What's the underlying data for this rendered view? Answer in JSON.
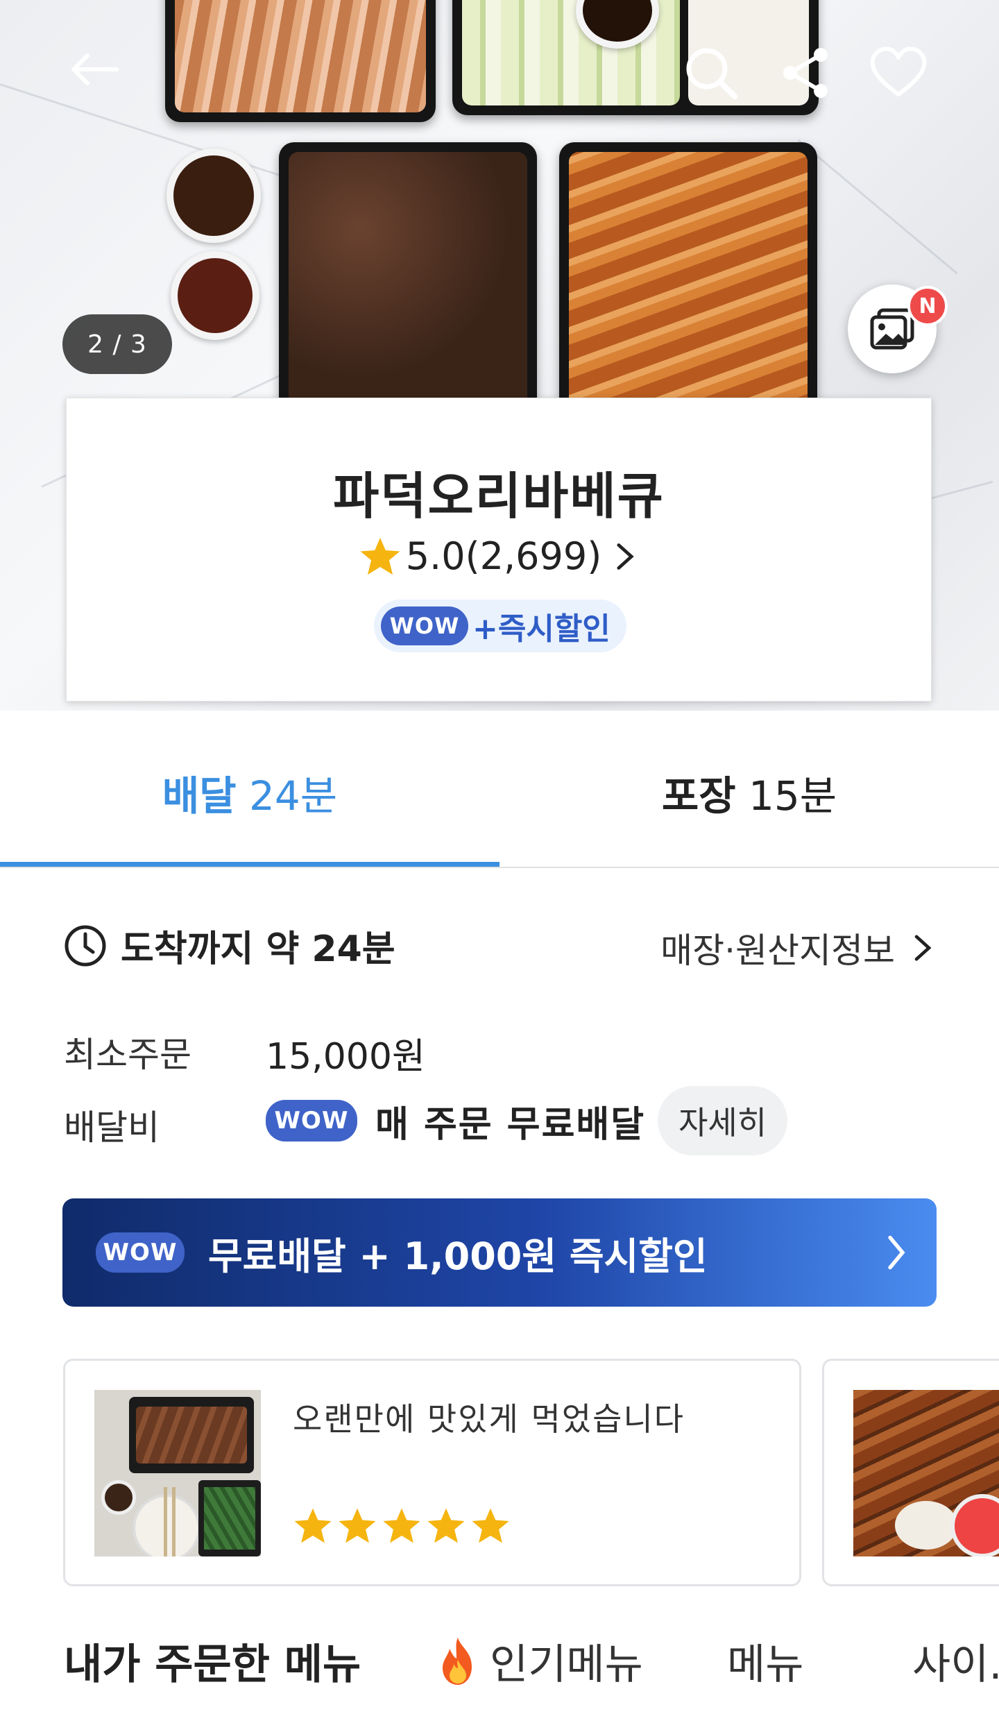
{
  "hero": {
    "image_counter": "2 / 3",
    "gallery_new_badge": "N"
  },
  "store": {
    "name": "파덕오리바베큐",
    "rating": "5.0",
    "review_count": "(2,699)",
    "wow_label": "WOW",
    "instant_discount_label": "+즉시할인"
  },
  "tabs": {
    "delivery": {
      "label": "배달",
      "time": "24분"
    },
    "pickup": {
      "label": "포장",
      "time": "15분"
    }
  },
  "info": {
    "eta_label": "도착까지 약 24분",
    "store_info_link": "매장·원산지정보",
    "min_order_label": "최소주문",
    "min_order_value": "15,000원",
    "delivery_fee_label": "배달비",
    "wow_label": "WOW",
    "delivery_fee_value": "매 주문 무료배달",
    "detail_button": "자세히"
  },
  "banner": {
    "wow_label": "WOW",
    "text": "무료배달 + 1,000원 즉시할인"
  },
  "reviews": [
    {
      "text": "오랜만에 맛있게 먹었습니다",
      "stars": 5
    }
  ],
  "menu_tabs": {
    "ordered": "내가 주문한 메뉴",
    "popular": "인기메뉴",
    "menu": "메뉴",
    "side": "사이."
  },
  "colors": {
    "accent": "#3b8fe0",
    "wow": "#3f63c8",
    "star": "#f5b40f"
  }
}
